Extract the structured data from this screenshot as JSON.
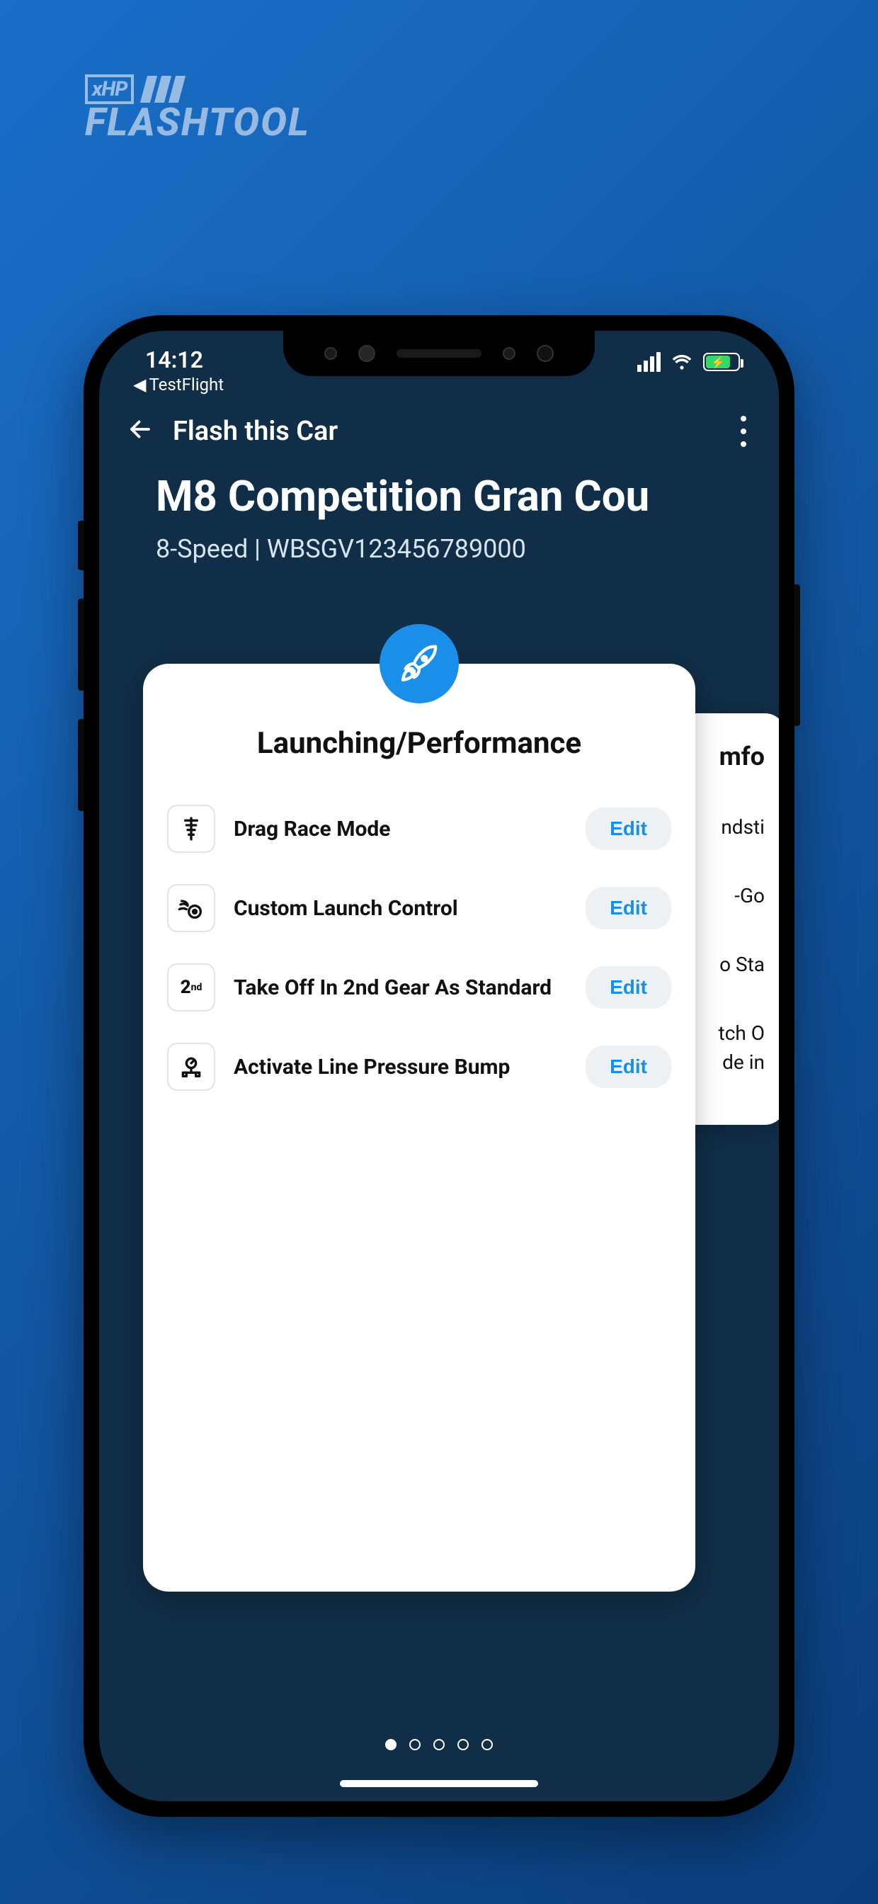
{
  "logo": {
    "brand_small": "xHP",
    "brand_big": "FLASHTOOL"
  },
  "statusbar": {
    "time": "14:12",
    "back_app_prefix": "◀",
    "back_app": "TestFlight"
  },
  "appbar": {
    "title": "Flash this Car"
  },
  "car": {
    "name": "M8 Competition Gran Cou",
    "subtitle": "8-Speed | WBSGV123456789000"
  },
  "main_card": {
    "title": "Launching/Performance",
    "options": [
      {
        "label": "Drag Race Mode",
        "button": "Edit",
        "icon": "drag-tree-icon"
      },
      {
        "label": "Custom Launch Control",
        "button": "Edit",
        "icon": "flame-wheel-icon"
      },
      {
        "label": "Take Off In 2nd Gear As Standard",
        "button": "Edit",
        "icon": "second-gear-icon"
      },
      {
        "label": "Activate Line Pressure Bump",
        "button": "Edit",
        "icon": "pressure-gauge-icon"
      }
    ]
  },
  "bg_card": {
    "title_fragment": "mfo",
    "items": [
      "ndsti",
      "-Go",
      "o Sta",
      "tch O",
      "de in"
    ]
  },
  "pager": {
    "count": 5,
    "active": 0
  }
}
